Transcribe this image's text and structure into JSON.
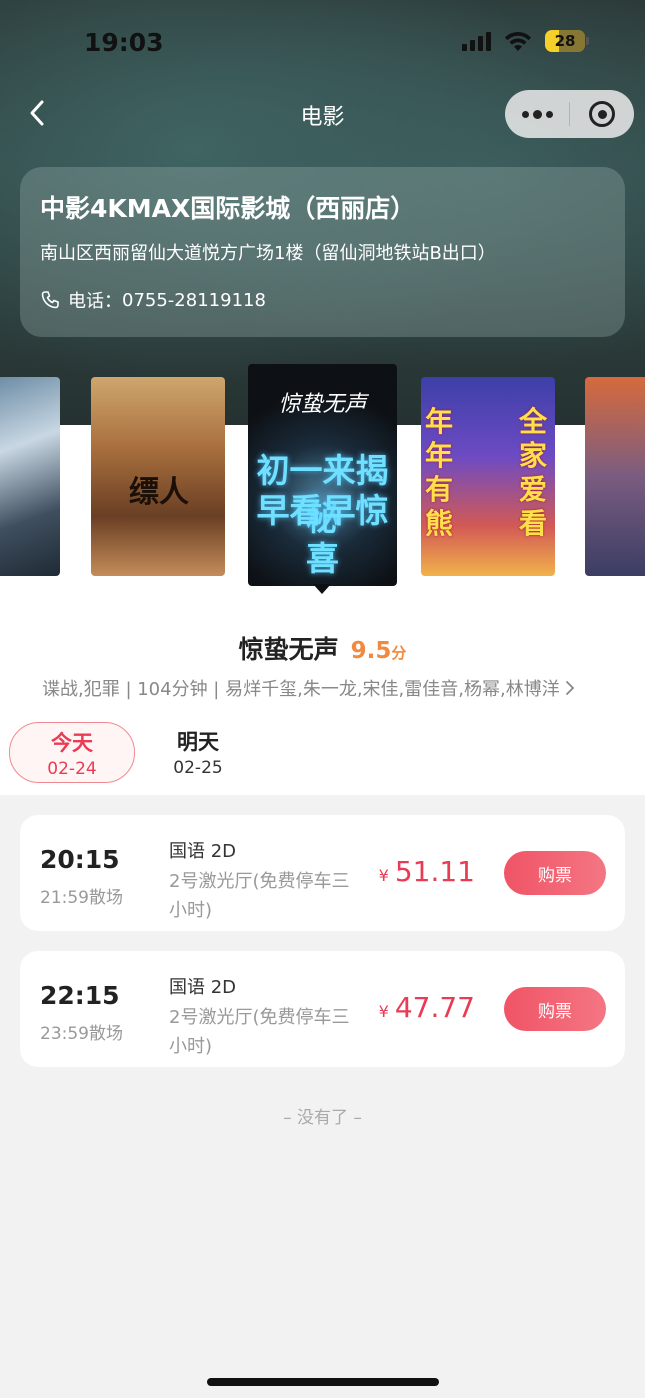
{
  "status_bar": {
    "time": "19:03",
    "battery": "28"
  },
  "nav": {
    "title": "电影",
    "back_icon": "chevron-left-icon",
    "more_icon": "more-dots-icon",
    "close_icon": "target-circle-icon"
  },
  "cinema": {
    "name": "中影4KMAX国际影城（西丽店）",
    "address": "南山区西丽留仙大道悦方广场1楼（留仙洞地铁站B出口）",
    "phone_label": "电话：",
    "phone": "0755-28119118"
  },
  "posters": [
    {
      "name": "poster-1"
    },
    {
      "name": "poster-2",
      "text": "缥人"
    },
    {
      "name": "poster-3",
      "title": "惊蛰无声",
      "line1": "初一来揭秘",
      "line2": "早看早惊喜",
      "selected": true
    },
    {
      "name": "poster-4",
      "text_left": "年年有熊",
      "text_right": "全家爱看"
    },
    {
      "name": "poster-5"
    }
  ],
  "movie": {
    "title": "惊蛰无声",
    "score": "9.5",
    "score_unit": "分",
    "meta": "谍战,犯罪 | 104分钟 | 易烊千玺,朱一龙,宋佳,雷佳音,杨幂,林博洋"
  },
  "dates": [
    {
      "label": "今天",
      "date": "02-24",
      "active": true
    },
    {
      "label": "明天",
      "date": "02-25",
      "active": false
    }
  ],
  "showtimes": [
    {
      "start": "20:15",
      "end": "21:59散场",
      "lang": "国语 2D",
      "hall": "2号激光厅(免费停车三小时)",
      "currency": "¥",
      "price": "51.11",
      "button": "购票"
    },
    {
      "start": "22:15",
      "end": "23:59散场",
      "lang": "国语 2D",
      "hall": "2号激光厅(免费停车三小时)",
      "currency": "¥",
      "price": "47.77",
      "button": "购票"
    }
  ],
  "footer": {
    "no_more": "– 没有了 –"
  },
  "colors": {
    "accent": "#ea3b55",
    "score": "#f08a3e"
  }
}
